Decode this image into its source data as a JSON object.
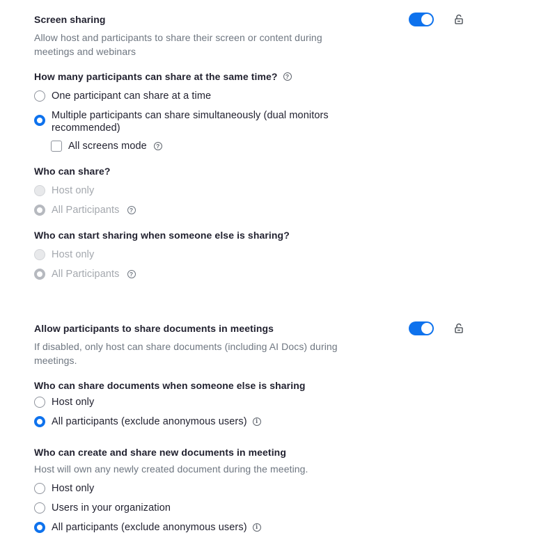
{
  "screen_sharing": {
    "title": "Screen sharing",
    "description": "Allow host and participants to share their screen or content during meetings and webinars",
    "toggle_on": true,
    "how_many": {
      "question": "How many participants can share at the same time?",
      "options": [
        {
          "label": "One participant can share at a time",
          "checked": false
        },
        {
          "label": "Multiple participants can share simultaneously (dual monitors recommended)",
          "checked": true
        }
      ],
      "all_screens_label": "All screens mode",
      "all_screens_checked": false
    },
    "who_can_share": {
      "question": "Who can share?",
      "options": [
        {
          "label": "Host only",
          "checked": false
        },
        {
          "label": "All Participants",
          "checked": true
        }
      ]
    },
    "who_can_start": {
      "question": "Who can start sharing when someone else is sharing?",
      "options": [
        {
          "label": "Host only",
          "checked": false
        },
        {
          "label": "All Participants",
          "checked": true
        }
      ]
    }
  },
  "documents": {
    "title": "Allow participants to share documents in meetings",
    "description": "If disabled, only host can share documents (including AI Docs) during meetings.",
    "toggle_on": true,
    "who_can_share_docs": {
      "question": "Who can share documents when someone else is sharing",
      "options": [
        {
          "label": "Host only",
          "checked": false
        },
        {
          "label": "All participants (exclude anonymous users)",
          "checked": true
        }
      ]
    },
    "who_can_create": {
      "question": "Who can create and share new documents in meeting",
      "note": "Host will own any newly created document during the meeting.",
      "options": [
        {
          "label": "Host only",
          "checked": false
        },
        {
          "label": "Users in your organization",
          "checked": false
        },
        {
          "label": "All participants (exclude anonymous users)",
          "checked": true
        }
      ]
    }
  },
  "icons": {
    "help": "?",
    "info": "i"
  },
  "colors": {
    "accent": "#0e72ed",
    "text": "#222230",
    "muted": "#6e7680",
    "disabled": "#a4a8ae"
  }
}
